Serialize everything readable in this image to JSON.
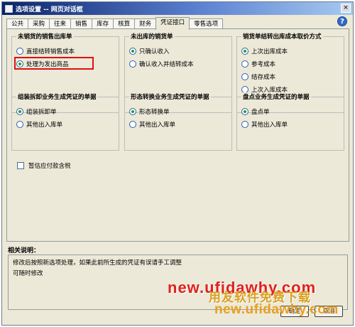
{
  "window": {
    "title": "选项设置 -- 网页对话框"
  },
  "tabs": [
    "公共",
    "采购",
    "往来",
    "销售",
    "库存",
    "核算",
    "财务",
    "凭证接口",
    "零售选项"
  ],
  "groups": {
    "unsold_outbound": {
      "title": "未销货的销售出库单",
      "options": [
        "直接结转销售成本",
        "处理为发出商品"
      ],
      "selected": 1
    },
    "outbound_not_stocked": {
      "title": "未出库的销货单",
      "options": [
        "只确认收入",
        "确认收入并结转成本"
      ],
      "selected": 0
    },
    "cost_method": {
      "title": "销货单结转出库成本取价方式",
      "options": [
        "上次出库成本",
        "参考成本",
        "结存成本",
        "上次入库成本"
      ],
      "selected": 0
    },
    "assembly_voucher": {
      "title": "组装拆卸业务生成凭证的单据",
      "options": [
        "组装拆卸单",
        "其他出入库单"
      ],
      "selected": 0
    },
    "transform_voucher": {
      "title": "形态转换业务生成凭证的单据",
      "options": [
        "形态转换单",
        "其他出入库单"
      ],
      "selected": 0
    },
    "inventory_voucher": {
      "title": "盘点业务生成凭证的单据",
      "options": [
        "盘点单",
        "其他出入库单"
      ],
      "selected": 0
    }
  },
  "estimate_tax_checkbox": {
    "label": "暂估应付款含税",
    "checked": false
  },
  "description": {
    "label": "相关说明：",
    "lines": [
      "修改后按照新选项处理，如果此前所生成的凭证有误请手工调整",
      "可随时修改"
    ]
  },
  "buttons": {
    "ok": "确定",
    "cancel": "取消"
  },
  "watermark": {
    "line1": "new.ufidawhy.com",
    "line1_cn": "用友软件免费下载",
    "line2": "new.ufidawhy.com"
  },
  "colors": {
    "title_bar": "#0a246a",
    "highlight": "#e01010",
    "radio_dot": "#21a121"
  }
}
